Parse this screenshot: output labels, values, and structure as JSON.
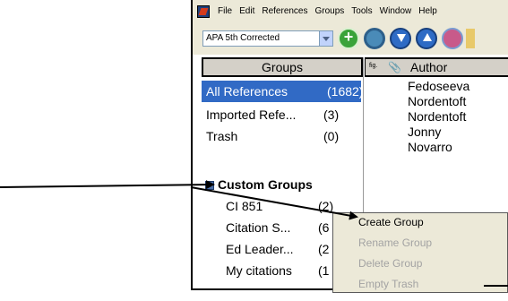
{
  "menubar": {
    "items": [
      "File",
      "Edit",
      "References",
      "Groups",
      "Tools",
      "Window",
      "Help"
    ]
  },
  "toolbar": {
    "style_select_value": "APA 5th Corrected"
  },
  "groups_panel": {
    "header": "Groups",
    "items": [
      {
        "label": "All References",
        "count": "(1682)"
      },
      {
        "label": "Imported Refe...",
        "count": "(3)"
      },
      {
        "label": "Trash",
        "count": "(0)"
      }
    ],
    "custom_groups": {
      "header": "Custom Groups",
      "items": [
        {
          "label": "CI 851",
          "count": "(2)"
        },
        {
          "label": "Citation S...",
          "count": "(6"
        },
        {
          "label": "Ed Leader...",
          "count": "(2"
        },
        {
          "label": "My citations",
          "count": "(1"
        }
      ]
    }
  },
  "reference_list": {
    "fig_label": "fig.",
    "attach_icon": "paperclip-icon",
    "author_header": "Author",
    "authors": [
      "Fedoseeva",
      "Nordentoft",
      "Nordentoft",
      "Jonny",
      "Novarro"
    ]
  },
  "context_menu": {
    "items": [
      {
        "label": "Create Group",
        "enabled": true
      },
      {
        "label": "Rename Group",
        "enabled": false
      },
      {
        "label": "Delete Group",
        "enabled": false
      },
      {
        "label": "Empty Trash",
        "enabled": false
      }
    ]
  }
}
